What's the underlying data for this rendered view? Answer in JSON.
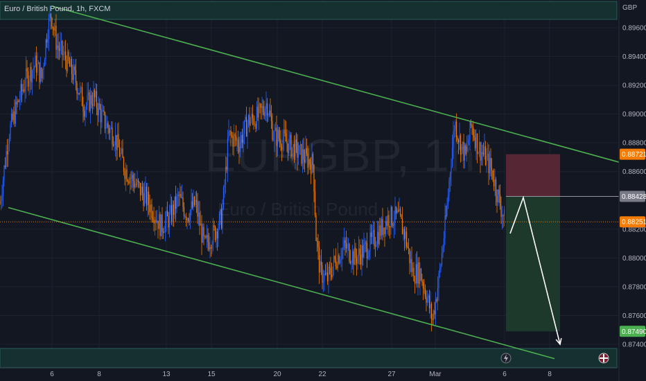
{
  "header": {
    "symbol_title": "Euro / British Pound, 1h, FXCM",
    "currency": "GBP",
    "watermark_symbol": "EURGBP, 1h",
    "watermark_name": "Euro / British Pound"
  },
  "colors": {
    "background": "#131722",
    "up": "#2962ff",
    "down": "#f57c00",
    "channel": "#4caf50",
    "stop_zone": "#5b2737",
    "target_zone": "#1e3b2c",
    "projection": "#ffffff",
    "price_line": "#f57c00"
  },
  "chart_data": {
    "type": "candlestick",
    "title": "Euro / British Pound, 1h, FXCM",
    "symbol": "EURGBP",
    "interval": "1h",
    "currency": "GBP",
    "y_range": [
      0.873,
      0.8975
    ],
    "y_ticks": [
      {
        "value": 0.896,
        "label": "0.89600"
      },
      {
        "value": 0.894,
        "label": "0.89400"
      },
      {
        "value": 0.892,
        "label": "0.89200"
      },
      {
        "value": 0.89,
        "label": "0.89000"
      },
      {
        "value": 0.888,
        "label": "0.88800"
      },
      {
        "value": 0.886,
        "label": "0.88600"
      },
      {
        "value": 0.882,
        "label": "0.88200"
      },
      {
        "value": 0.88,
        "label": "0.88000"
      },
      {
        "value": 0.878,
        "label": "0.87800"
      },
      {
        "value": 0.876,
        "label": "0.87600"
      },
      {
        "value": 0.874,
        "label": "0.87400"
      }
    ],
    "x_ticks": [
      {
        "bar": 75,
        "label": "6"
      },
      {
        "bar": 143,
        "label": "8"
      },
      {
        "bar": 240,
        "label": "13"
      },
      {
        "bar": 305,
        "label": "15"
      },
      {
        "bar": 400,
        "label": "20"
      },
      {
        "bar": 465,
        "label": "22"
      },
      {
        "bar": 565,
        "label": "27"
      },
      {
        "bar": 628,
        "label": "Mar"
      },
      {
        "bar": 728,
        "label": "6"
      },
      {
        "bar": 793,
        "label": "8"
      }
    ],
    "price_path": [
      [
        0,
        0.8838
      ],
      [
        12,
        0.8885
      ],
      [
        24,
        0.8905
      ],
      [
        38,
        0.8925
      ],
      [
        52,
        0.8935
      ],
      [
        60,
        0.8925
      ],
      [
        68,
        0.8958
      ],
      [
        74,
        0.897
      ],
      [
        82,
        0.8948
      ],
      [
        95,
        0.8938
      ],
      [
        108,
        0.8925
      ],
      [
        122,
        0.8905
      ],
      [
        135,
        0.8912
      ],
      [
        150,
        0.8895
      ],
      [
        165,
        0.8885
      ],
      [
        180,
        0.8862
      ],
      [
        195,
        0.8852
      ],
      [
        210,
        0.8842
      ],
      [
        222,
        0.8832
      ],
      [
        232,
        0.8822
      ],
      [
        245,
        0.8828
      ],
      [
        258,
        0.8842
      ],
      [
        270,
        0.883
      ],
      [
        282,
        0.8838
      ],
      [
        295,
        0.8808
      ],
      [
        310,
        0.8818
      ],
      [
        320,
        0.8828
      ],
      [
        330,
        0.8885
      ],
      [
        345,
        0.888
      ],
      [
        358,
        0.8895
      ],
      [
        372,
        0.8898
      ],
      [
        385,
        0.8908
      ],
      [
        395,
        0.8885
      ],
      [
        410,
        0.8882
      ],
      [
        425,
        0.8875
      ],
      [
        440,
        0.887
      ],
      [
        452,
        0.8865
      ],
      [
        456,
        0.8815
      ],
      [
        462,
        0.879
      ],
      [
        472,
        0.8785
      ],
      [
        485,
        0.88
      ],
      [
        498,
        0.8808
      ],
      [
        512,
        0.88
      ],
      [
        525,
        0.8805
      ],
      [
        538,
        0.8812
      ],
      [
        550,
        0.882
      ],
      [
        560,
        0.8828
      ],
      [
        575,
        0.8828
      ],
      [
        585,
        0.8815
      ],
      [
        595,
        0.879
      ],
      [
        606,
        0.879
      ],
      [
        615,
        0.8775
      ],
      [
        624,
        0.8757
      ],
      [
        634,
        0.8788
      ],
      [
        644,
        0.883
      ],
      [
        650,
        0.8865
      ],
      [
        656,
        0.8895
      ],
      [
        664,
        0.888
      ],
      [
        672,
        0.887
      ],
      [
        680,
        0.8893
      ],
      [
        690,
        0.8877
      ],
      [
        700,
        0.887
      ],
      [
        710,
        0.886
      ],
      [
        720,
        0.884
      ],
      [
        728,
        0.8826
      ]
    ],
    "channel": {
      "upper": [
        [
          75,
          0.8975
        ],
        [
          935,
          0.8861
        ]
      ],
      "lower": [
        [
          12,
          0.8835
        ],
        [
          800,
          0.873
        ]
      ]
    },
    "position": {
      "direction": "short",
      "start_bar": 730,
      "end_bar": 808,
      "entry": 0.88428,
      "stop": 0.88721,
      "target": 0.8749
    },
    "projection_path": [
      [
        736,
        0.8817
      ],
      [
        755,
        0.8842
      ],
      [
        808,
        0.874
      ]
    ],
    "price_labels": [
      {
        "value": 0.88721,
        "label": "0.88721",
        "color": "#f57c00"
      },
      {
        "value": 0.88428,
        "label": "0.88428",
        "color": "#787b86"
      },
      {
        "value": 0.88251,
        "label": "0.88251",
        "color": "#f57c00"
      },
      {
        "value": 0.8749,
        "label": "0.87490",
        "color": "#4caf50"
      }
    ],
    "current_price": 0.88251
  }
}
